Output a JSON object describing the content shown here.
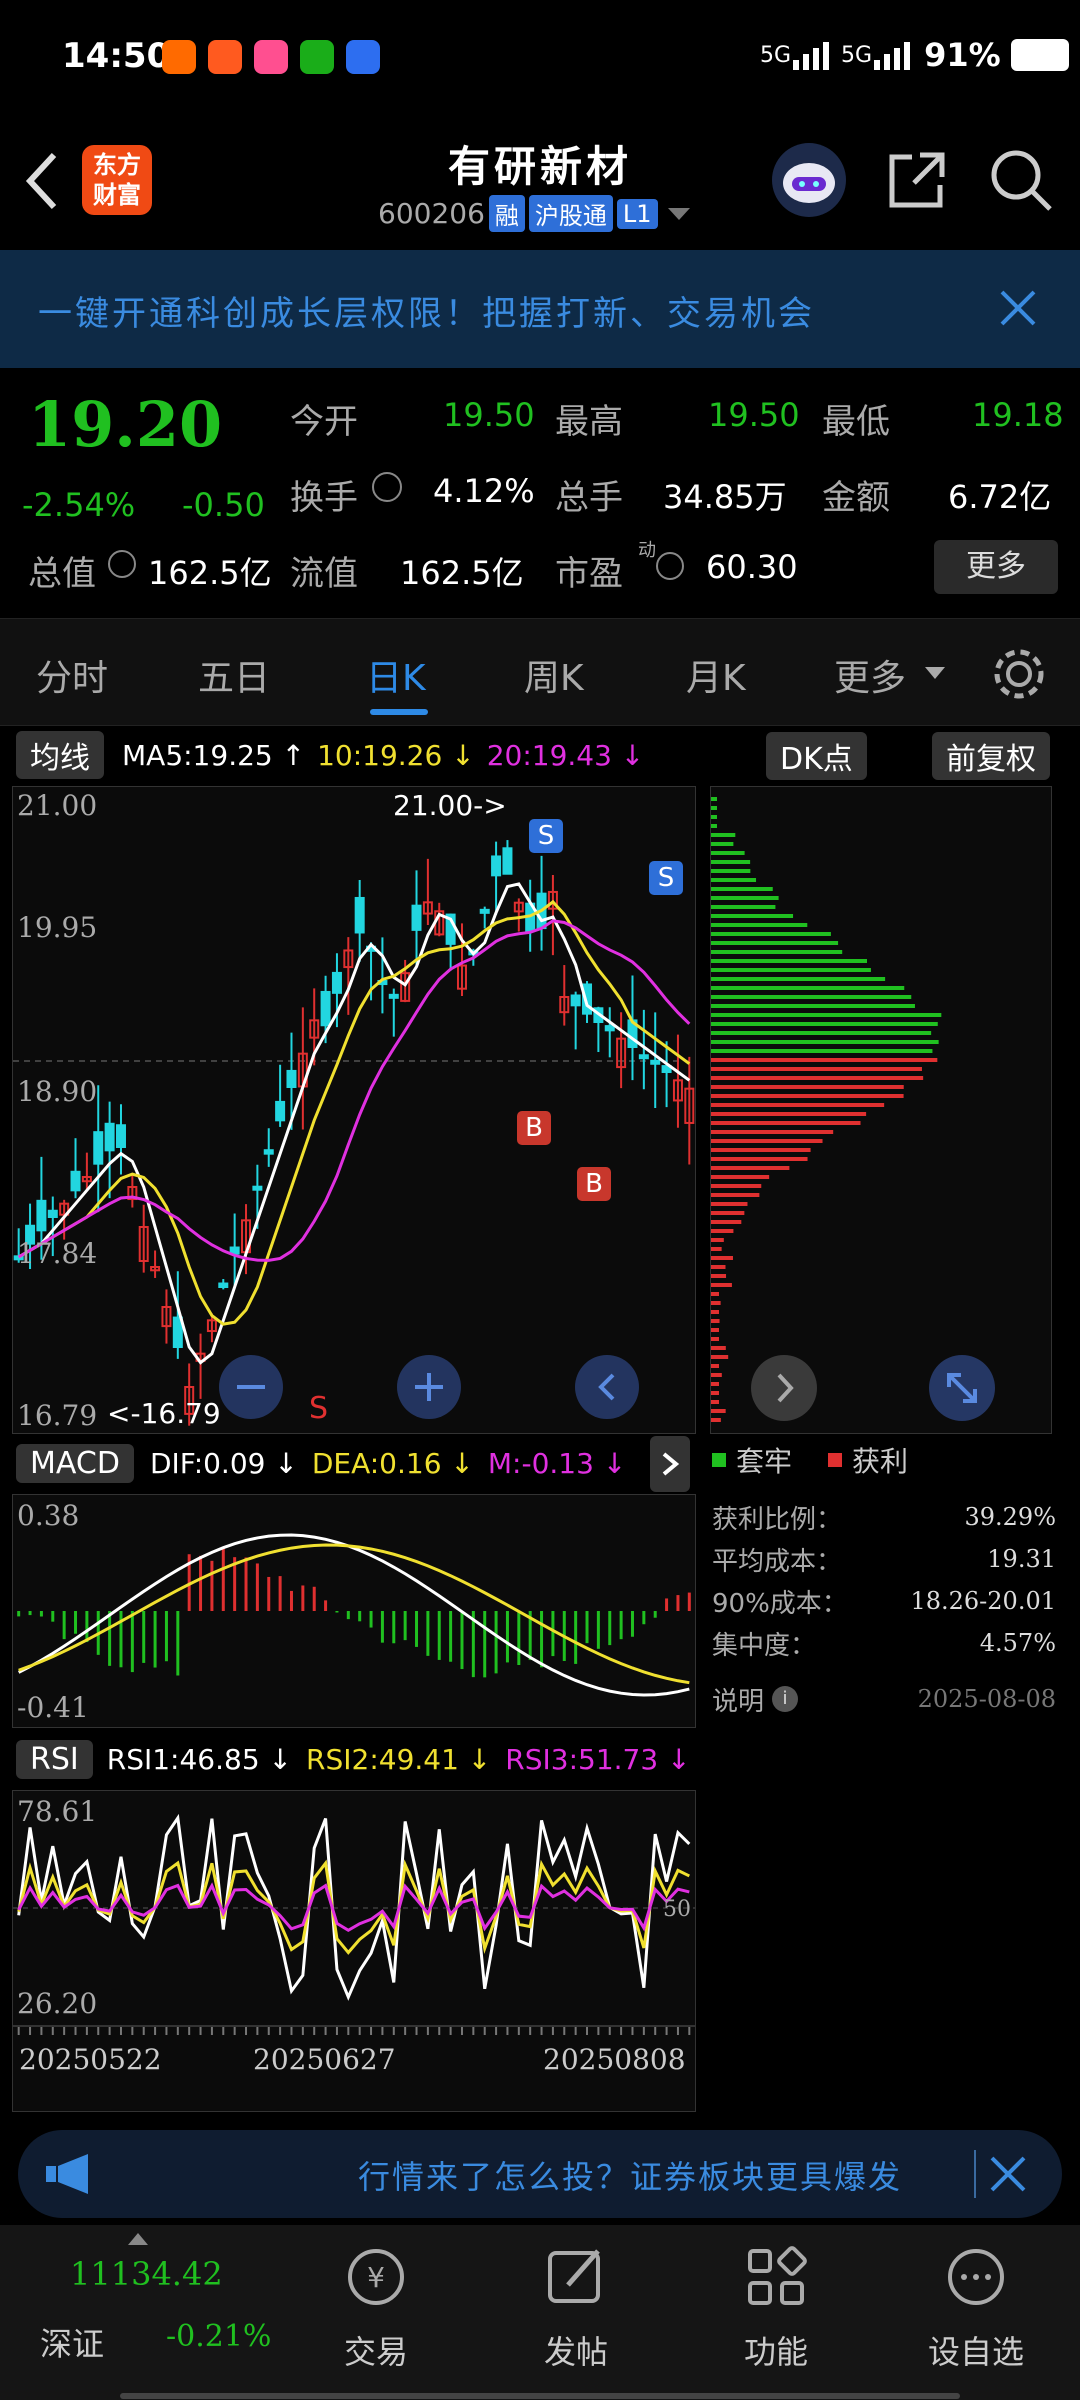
{
  "status": {
    "time": "14:50",
    "signal1": "5G",
    "signal2": "5G",
    "battery": "91%"
  },
  "header": {
    "logo_line1": "东方",
    "logo_line2": "财富",
    "title": "有研新材",
    "code": "600206",
    "tag_rong": "融",
    "tag_hgt": "沪股通",
    "tag_l1": "L1"
  },
  "banner": {
    "text": "一键开通科创成长层权限！把握打新、交易机会"
  },
  "quote": {
    "price": "19.20",
    "pct": "-2.54%",
    "chg": "-0.50",
    "open_label": "今开",
    "open": "19.50",
    "high_label": "最高",
    "high": "19.50",
    "low_label": "最低",
    "low": "19.18",
    "turnover_label": "换手",
    "turnover": "4.12%",
    "volume_label": "总手",
    "volume": "34.85万",
    "amount_label": "金额",
    "amount": "6.72亿",
    "mktcap_label": "总值",
    "mktcap": "162.5亿",
    "float_label": "流值",
    "float": "162.5亿",
    "pe_label": "市盈",
    "pe_sup": "动",
    "pe": "60.30",
    "more": "更多"
  },
  "tabs": [
    "分时",
    "五日",
    "日K",
    "周K",
    "月K",
    "更多"
  ],
  "ma_legend": {
    "btn": "均线",
    "ma5": "MA5:19.25 ↑",
    "ma10": "10:19.26 ↓",
    "ma20": "20:19.43 ↓",
    "dk": "DK点",
    "fq": "前复权"
  },
  "kline": {
    "y_labels": [
      "21.00",
      "19.95",
      "18.90",
      "17.84",
      "16.79"
    ],
    "high_ann": "21.00->",
    "low_ann": "<-16.79",
    "s_mark": "S",
    "b_mark": "B"
  },
  "macd": {
    "btn": "MACD",
    "dif": "DIF:0.09 ↓",
    "dea": "DEA:0.16 ↓",
    "m": "M:-0.13 ↓",
    "top": "0.38",
    "bottom": "-0.41"
  },
  "rsi": {
    "btn": "RSI",
    "r1": "RSI1:46.85 ↓",
    "r2": "RSI2:49.41 ↓",
    "r3": "RSI3:51.73 ↓",
    "top": "78.61",
    "bottom": "26.20",
    "mid": "50"
  },
  "dates": [
    "20250522",
    "20250627",
    "20250808"
  ],
  "chips": {
    "legend_trap": "套牢",
    "legend_profit": "获利",
    "rows": [
      {
        "label": "获利比例：",
        "value": "39.29%"
      },
      {
        "label": "平均成本：",
        "value": "19.31"
      },
      {
        "label": "90%成本：",
        "value": "18.26-20.01"
      },
      {
        "label": "集中度：",
        "value": "4.57%"
      }
    ],
    "note": "说明",
    "date": "2025-08-08"
  },
  "notice": {
    "text": "行情来了怎么投？证券板块更具爆发"
  },
  "bottom": {
    "index_value": "11134.42",
    "index_name": "深证",
    "index_pct": "-0.21%",
    "nav": [
      "交易",
      "发帖",
      "功能",
      "设自选"
    ]
  },
  "colors": {
    "up": "#e03030",
    "down": "#20c020",
    "cyan": "#22d6e0",
    "ma10": "#f0e030",
    "ma20": "#e030e0",
    "accent": "#2e8ae6"
  }
}
